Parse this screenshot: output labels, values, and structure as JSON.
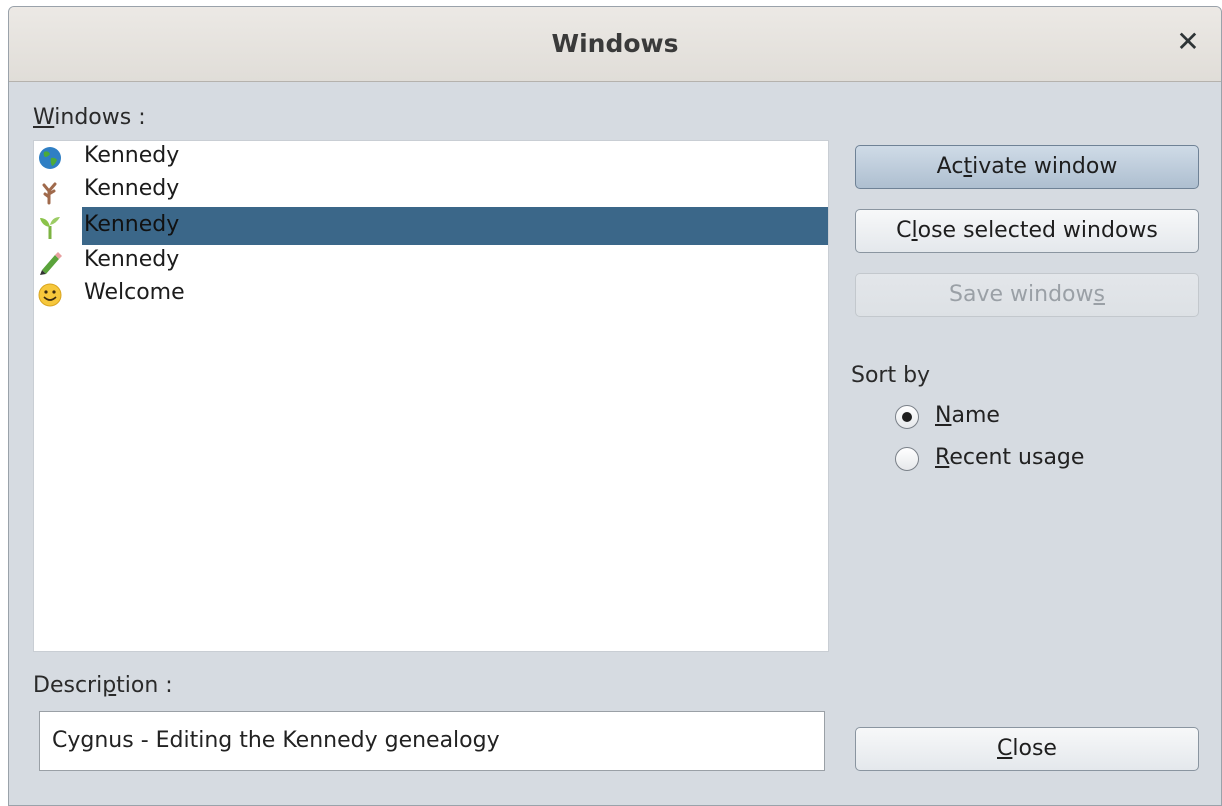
{
  "dialog": {
    "title": "Windows",
    "close_icon": "close-icon"
  },
  "windows_label": {
    "pre": "",
    "mnemonic": "W",
    "post": "indows :"
  },
  "windows_list": [
    {
      "label": "Kennedy",
      "icon": "globe-icon",
      "selected": false
    },
    {
      "label": "Kennedy",
      "icon": "tree-icon",
      "selected": false
    },
    {
      "label": "Kennedy",
      "icon": "sprout-icon",
      "selected": true
    },
    {
      "label": "Kennedy",
      "icon": "pencil-icon",
      "selected": false
    },
    {
      "label": "Welcome",
      "icon": "smiley-icon",
      "selected": false
    }
  ],
  "buttons": {
    "activate": {
      "pre": "Ac",
      "mnemonic": "t",
      "post": "ivate window"
    },
    "close_selected": {
      "pre": "C",
      "mnemonic": "l",
      "post": "ose selected windows"
    },
    "save": {
      "pre": "Save window",
      "mnemonic": "s",
      "post": ""
    },
    "close": {
      "pre": "",
      "mnemonic": "C",
      "post": "lose"
    }
  },
  "sort_by": {
    "label": "Sort by",
    "options": [
      {
        "pre": "",
        "mnemonic": "N",
        "post": "ame",
        "checked": true
      },
      {
        "pre": "",
        "mnemonic": "R",
        "post": "ecent usage",
        "checked": false
      }
    ]
  },
  "description": {
    "label": {
      "pre": "Descri",
      "mnemonic": "p",
      "post": "tion :"
    },
    "value": "Cygnus - Editing the Kennedy genealogy"
  },
  "colors": {
    "dialog_bg": "#d6dbe1",
    "selection": "#3b6789"
  }
}
